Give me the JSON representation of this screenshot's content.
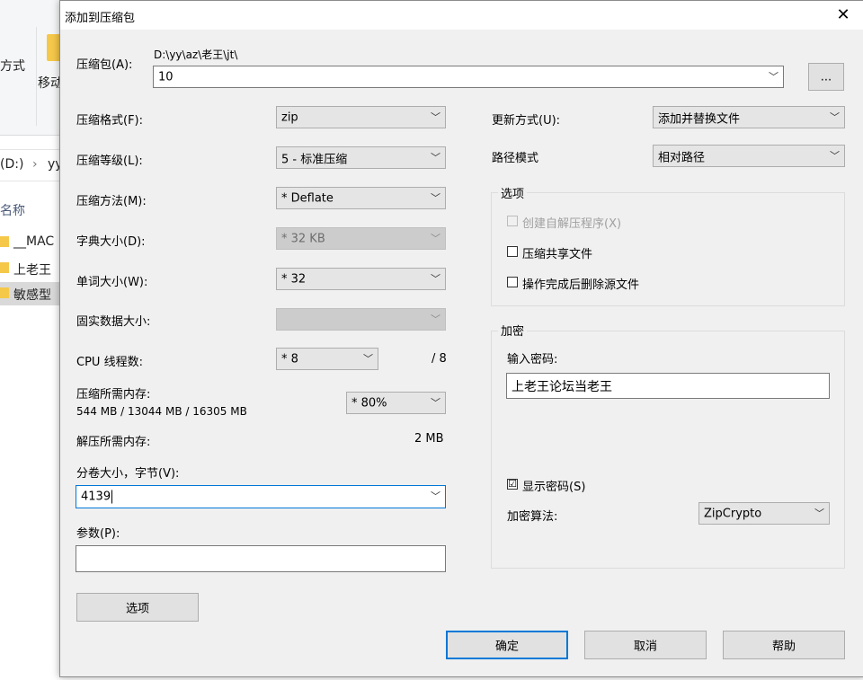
{
  "background": {
    "ribbon_text_1": "方式",
    "ribbon_text_2": "移动",
    "address_text": "(D:)",
    "address_sep": "›",
    "address_text_2": "yy",
    "list_header": "名称",
    "files": [
      "__MAC",
      "上老王",
      "敏感型"
    ]
  },
  "dialog": {
    "title": "添加到压缩包",
    "close_glyph": "✕",
    "archive_label": "压缩包(A):",
    "archive_path": "D:\\yy\\az\\老王\\jt\\",
    "archive_name": "10",
    "browse_label": "...",
    "format_label": "压缩格式(F):",
    "format_value": "zip",
    "level_label": "压缩等级(L):",
    "level_value": "5 - 标准压缩",
    "method_label": "压缩方法(M):",
    "method_value": "* Deflate",
    "dict_label": "字典大小(D):",
    "dict_value": "* 32 KB",
    "word_label": "单词大小(W):",
    "word_value": "* 32",
    "solid_label": "固实数据大小:",
    "solid_value": "",
    "cpu_label": "CPU 线程数:",
    "cpu_value": "* 8",
    "cpu_max": "/ 8",
    "mem_label": "压缩所需内存:",
    "mem_detail": "544 MB / 13044 MB / 16305 MB",
    "mem_value": "* 80%",
    "decomp_label": "解压所需内存:",
    "decomp_value": "2 MB",
    "split_label": "分卷大小，字节(V):",
    "split_value": "4139",
    "params_label": "参数(P):",
    "params_value": "",
    "options_button": "选项",
    "update_label": "更新方式(U):",
    "update_value": "添加并替换文件",
    "path_label": "路径模式",
    "path_value": "相对路径",
    "options_group": "选项",
    "opt_sfx": "创建自解压程序(X)",
    "opt_shared": "压缩共享文件",
    "opt_delete": "操作完成后删除源文件",
    "encrypt_group": "加密",
    "password_label": "输入密码:",
    "password_value": "上老王论坛当老王",
    "show_password": "显示密码(S)",
    "show_password_check": "☑",
    "algo_label": "加密算法:",
    "algo_value": "ZipCrypto",
    "ok_button": "确定",
    "cancel_button": "取消",
    "help_button": "帮助",
    "chevron": "﹀"
  }
}
